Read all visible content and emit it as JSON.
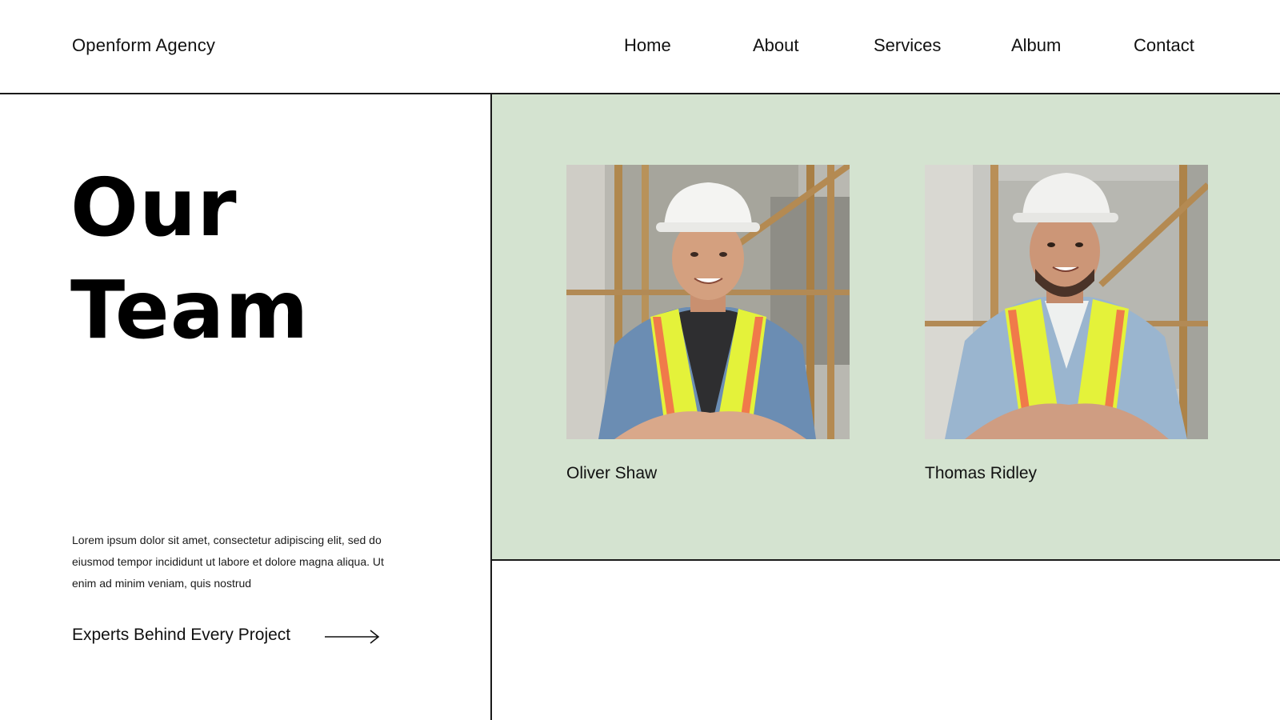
{
  "header": {
    "brand": "Openform Agency",
    "nav": [
      "Home",
      "About",
      "Services",
      "Album",
      "Contact"
    ]
  },
  "hero": {
    "title_line1": "Our",
    "title_line2": "Team",
    "body": "Lorem ipsum dolor sit amet, consectetur adipiscing elit, sed do eiusmod tempor incididunt ut labore et dolore magna aliqua. Ut enim ad minim veniam, quis nostrud",
    "cta_label": "Experts Behind Every Project"
  },
  "team": {
    "members": [
      {
        "name": "Oliver Shaw"
      },
      {
        "name": "Thomas Ridley"
      }
    ]
  },
  "colors": {
    "panel": "#d4e3d0",
    "line": "#1a1a1a",
    "vest": "#e4f23a",
    "vest_stripe": "#f07a4a",
    "helmet": "#f4f4f2",
    "shirt": "#6f8fb3"
  }
}
